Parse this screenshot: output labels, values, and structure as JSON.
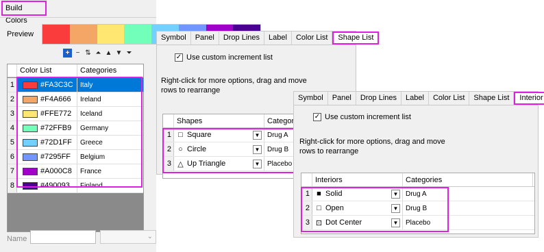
{
  "build_colors": {
    "title": "Build Colors",
    "preview_label": "Preview",
    "preview_colors": [
      "#FA3C3C",
      "#F4A666",
      "#FFE772",
      "#72FFB9",
      "#72D1FF",
      "#7295FF",
      "#A000C8",
      "#490093"
    ],
    "toolbar": [
      {
        "icon": "add-icon",
        "glyph": "+"
      },
      {
        "icon": "remove-icon",
        "glyph": "−"
      },
      {
        "icon": "sort-icon",
        "glyph": "⇅"
      },
      {
        "icon": "move-top-icon",
        "glyph": "⏶"
      },
      {
        "icon": "move-up-icon",
        "glyph": "▲"
      },
      {
        "icon": "move-down-icon",
        "glyph": "▼"
      },
      {
        "icon": "move-bottom-icon",
        "glyph": "⏷"
      }
    ],
    "columns": [
      "Color List",
      "Categories"
    ],
    "rows": [
      {
        "n": "1",
        "hex": "#FA3C3C",
        "cat": "Italy"
      },
      {
        "n": "2",
        "hex": "#F4A666",
        "cat": "Ireland"
      },
      {
        "n": "3",
        "hex": "#FFE772",
        "cat": "Iceland"
      },
      {
        "n": "4",
        "hex": "#72FFB9",
        "cat": "Germany"
      },
      {
        "n": "5",
        "hex": "#72D1FF",
        "cat": "Greece"
      },
      {
        "n": "6",
        "hex": "#7295FF",
        "cat": "Belgium"
      },
      {
        "n": "7",
        "hex": "#A000C8",
        "cat": "France"
      },
      {
        "n": "8",
        "hex": "#490093",
        "cat": "Finland"
      }
    ],
    "name_label": "Name",
    "name_value": ""
  },
  "shape_panel": {
    "tabs": [
      "Symbol",
      "Panel",
      "Drop Lines",
      "Label",
      "Color List",
      "Shape List"
    ],
    "active_tab": "Shape List",
    "checkbox_label": "Use custom increment list",
    "checked": true,
    "note_line1": "Right-click for more options, drag and move",
    "note_line2": "rows to  rearrange",
    "columns": [
      "Shapes",
      "Categories"
    ],
    "rows": [
      {
        "n": "1",
        "symbol": "square",
        "glyph": "□",
        "label": "Square",
        "cat": "Drug A"
      },
      {
        "n": "2",
        "symbol": "circle",
        "glyph": "○",
        "label": "Circle",
        "cat": "Drug B"
      },
      {
        "n": "3",
        "symbol": "up-triangle",
        "glyph": "△",
        "label": "Up Triangle",
        "cat": "Placebo"
      }
    ]
  },
  "interior_panel": {
    "tabs": [
      "Symbol",
      "Panel",
      "Drop Lines",
      "Label",
      "Color List",
      "Shape List",
      "Interior List"
    ],
    "active_tab": "Interior List",
    "checkbox_label": "Use custom increment list",
    "checked": true,
    "note_line1": "Right-click for more options, drag and move",
    "note_line2": "rows to  rearrange",
    "columns": [
      "Interiors",
      "Categories"
    ],
    "rows": [
      {
        "n": "1",
        "interior": "solid",
        "glyph": "■",
        "label": "Solid",
        "cat": "Drug A"
      },
      {
        "n": "2",
        "interior": "open",
        "glyph": "□",
        "label": "Open",
        "cat": "Drug B"
      },
      {
        "n": "3",
        "interior": "dot-center",
        "glyph": "⊡",
        "label": "Dot Center",
        "cat": "Placebo"
      }
    ]
  }
}
